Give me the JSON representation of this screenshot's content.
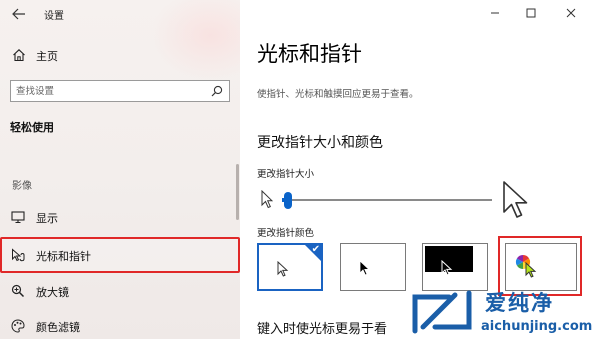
{
  "window": {
    "title": "设置",
    "controls": [
      "minimize",
      "maximize",
      "close"
    ]
  },
  "sidebar": {
    "home_label": "主页",
    "search_placeholder": "查找设置",
    "section_title": "轻松使用",
    "group_label": "影像",
    "items": [
      {
        "label": "显示",
        "icon": "monitor-icon",
        "selected": false
      },
      {
        "label": "光标和指针",
        "icon": "pointer-icon",
        "selected": true
      },
      {
        "label": "放大镜",
        "icon": "magnifier-icon",
        "selected": false
      },
      {
        "label": "颜色滤镜",
        "icon": "palette-icon",
        "selected": false
      }
    ]
  },
  "main": {
    "title": "光标和指针",
    "description": "使指针、光标和触摸回应更易于查看。",
    "size_color_heading": "更改指针大小和颜色",
    "pointer_size_label": "更改指针大小",
    "pointer_size_value": 1,
    "pointer_size_range": [
      1,
      15
    ],
    "pointer_color_label": "更改指针颜色",
    "color_options": [
      {
        "name": "white",
        "selected": true
      },
      {
        "name": "black",
        "selected": false
      },
      {
        "name": "inverted",
        "selected": false
      },
      {
        "name": "custom",
        "selected": false
      }
    ],
    "next_heading": "键入时使光标更易于看"
  },
  "watermark": {
    "brand": "爱纯净",
    "url": "aichunjing.com"
  },
  "colors": {
    "accent": "#0a63c9",
    "highlight": "#e02828",
    "brand": "#1a5ea8"
  }
}
